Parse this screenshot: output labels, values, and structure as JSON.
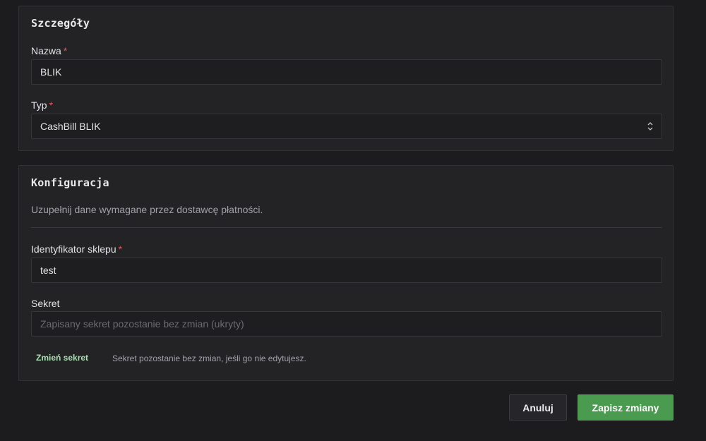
{
  "details": {
    "title": "Szczegóły",
    "name_label": "Nazwa",
    "name_value": "BLIK",
    "type_label": "Typ",
    "type_value": "CashBill BLIK",
    "required_mark": "*"
  },
  "config": {
    "title": "Konfiguracja",
    "description": "Uzupełnij dane wymagane przez dostawcę płatności.",
    "shop_id_label": "Identyfikator sklepu",
    "shop_id_value": "test",
    "secret_label": "Sekret",
    "secret_placeholder": "Zapisany sekret pozostanie bez zmian (ukryty)",
    "change_secret_label": "Zmień sekret",
    "secret_hint": "Sekret pozostanie bez zmian, jeśli go nie edytujesz."
  },
  "actions": {
    "cancel_label": "Anuluj",
    "save_label": "Zapisz zmiany"
  },
  "colors": {
    "accent": "#4a9a4f",
    "link": "#a7e0b0",
    "required": "#e05555"
  }
}
